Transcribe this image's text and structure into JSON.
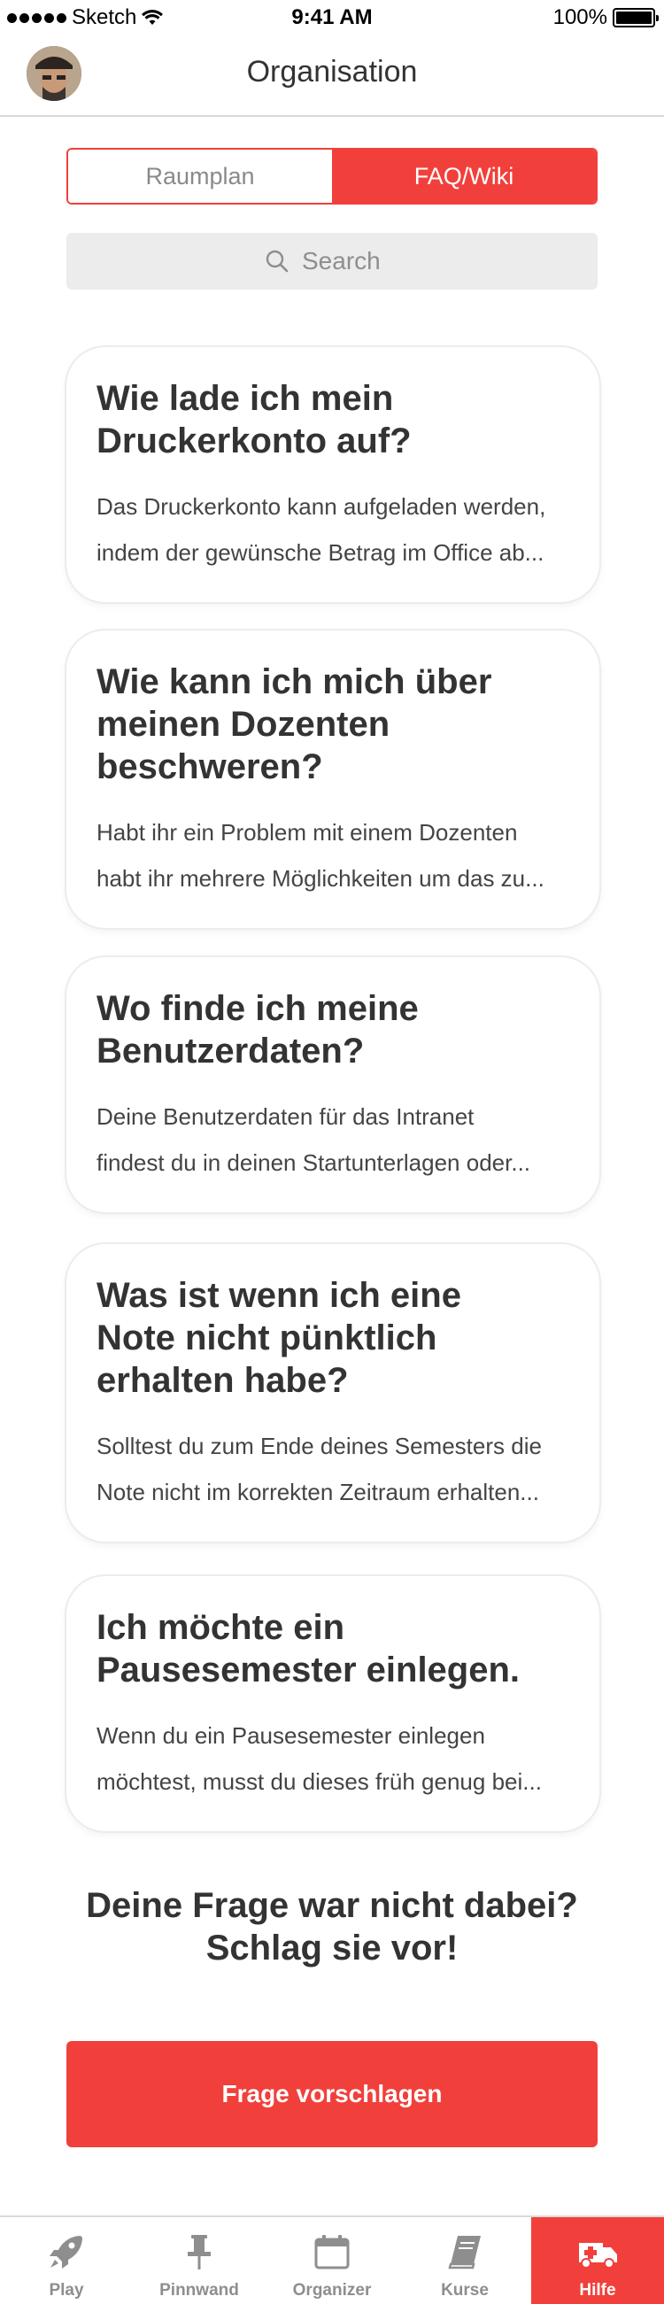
{
  "status_bar": {
    "carrier": "Sketch",
    "time": "9:41 AM",
    "battery": "100%"
  },
  "nav": {
    "title": "Organisation"
  },
  "segment": {
    "items": [
      "Raumplan",
      "FAQ/Wiki"
    ],
    "active_index": 1
  },
  "search": {
    "placeholder": "Search"
  },
  "faq": [
    {
      "title_lines": [
        "Wie lade ich mein",
        "Druckerkonto auf?"
      ],
      "text_lines": [
        "Das Druckerkonto kann aufgeladen werden,",
        "indem der gewünsche Betrag im Office ab..."
      ]
    },
    {
      "title_lines": [
        "Wie kann ich mich über",
        "meinen Dozenten",
        "beschweren?"
      ],
      "text_lines": [
        "Habt ihr ein Problem mit einem Dozenten",
        "habt ihr mehrere Möglichkeiten um das zu..."
      ]
    },
    {
      "title_lines": [
        "Wo finde ich meine",
        "Benutzerdaten?"
      ],
      "text_lines": [
        "Deine Benutzerdaten für das Intranet",
        "findest du in deinen Startunterlagen oder..."
      ]
    },
    {
      "title_lines": [
        "Was ist wenn ich eine",
        "Note nicht pünktlich",
        "erhalten habe?"
      ],
      "text_lines": [
        "Solltest du zum Ende deines Semesters die",
        "Note nicht im korrekten Zeitraum erhalten..."
      ]
    },
    {
      "title_lines": [
        "Ich möchte ein",
        "Pausesemester einlegen."
      ],
      "text_lines": [
        "Wenn du ein Pausesemester einlegen",
        "möchtest, musst du dieses früh genug bei..."
      ]
    }
  ],
  "suggest": {
    "heading_lines": [
      "Deine Frage war nicht dabei?",
      "Schlag sie vor!"
    ],
    "button_label": "Frage vorschlagen"
  },
  "tab_bar": {
    "items": [
      {
        "label": "Play",
        "icon": "rocket-icon"
      },
      {
        "label": "Pinnwand",
        "icon": "pin-icon"
      },
      {
        "label": "Organizer",
        "icon": "calendar-icon"
      },
      {
        "label": "Kurse",
        "icon": "book-icon"
      },
      {
        "label": "Hilfe",
        "icon": "ambulance-icon"
      }
    ],
    "active_index": 4
  },
  "colors": {
    "accent": "#f1403b",
    "text": "#333333",
    "muted": "#8e8e8e",
    "search_bg": "#ececec"
  }
}
